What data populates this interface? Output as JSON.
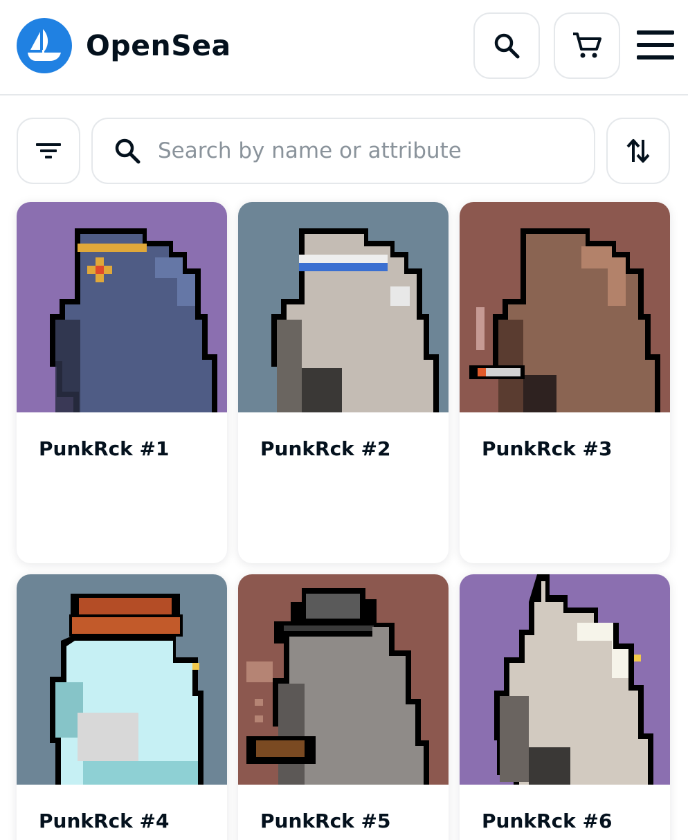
{
  "header": {
    "brand": "OpenSea",
    "logo_icon": "opensea-ship-icon",
    "search_icon": "search-icon",
    "cart_icon": "cart-icon",
    "menu_icon": "hamburger-menu-icon",
    "brand_color": "#2081e2"
  },
  "toolbar": {
    "filter_icon": "filter-icon",
    "search_placeholder": "Search by name or attribute",
    "search_value": "",
    "sort_icon": "sort-arrows-icon"
  },
  "items": [
    {
      "name": "PunkRck #1",
      "bg": "#8b6fb0"
    },
    {
      "name": "PunkRck #2",
      "bg": "#6d8596"
    },
    {
      "name": "PunkRck #3",
      "bg": "#8c584f"
    },
    {
      "name": "PunkRck #4",
      "bg": "#6d8596"
    },
    {
      "name": "PunkRck #5",
      "bg": "#8c584f"
    },
    {
      "name": "PunkRck #6",
      "bg": "#8b6fb0"
    }
  ]
}
